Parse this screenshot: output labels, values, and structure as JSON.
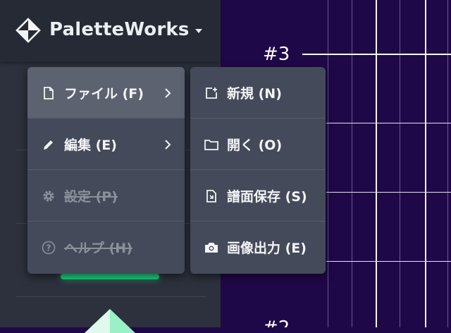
{
  "app": {
    "title": "PaletteWorks"
  },
  "canvas": {
    "marker_top": "#3",
    "marker_bottom": "#2"
  },
  "menu": {
    "items": [
      {
        "label": "ファイル (F)",
        "icon": "file-icon",
        "enabled": true,
        "active": true,
        "has_submenu": true
      },
      {
        "label": "編集 (E)",
        "icon": "pencil-icon",
        "enabled": true,
        "active": false,
        "has_submenu": true
      },
      {
        "label": "設定 (P)",
        "icon": "gear-icon",
        "enabled": false,
        "active": false,
        "has_submenu": false
      },
      {
        "label": "ヘルプ (H)",
        "icon": "help-circle-icon",
        "enabled": false,
        "active": false,
        "has_submenu": false
      }
    ]
  },
  "submenu": {
    "items": [
      {
        "label": "新規 (N)",
        "icon": "new-file-icon"
      },
      {
        "label": "開く (O)",
        "icon": "folder-icon"
      },
      {
        "label": "譜面保存 (S)",
        "icon": "save-score-icon"
      },
      {
        "label": "画像出力 (E)",
        "icon": "camera-icon"
      }
    ]
  },
  "colors": {
    "canvas_bg": "#1f0848",
    "sidebar_bg": "#2c313d",
    "menu_bg": "#444a59",
    "menu_active": "#5d6271",
    "accent_green": "#1fd37f"
  }
}
